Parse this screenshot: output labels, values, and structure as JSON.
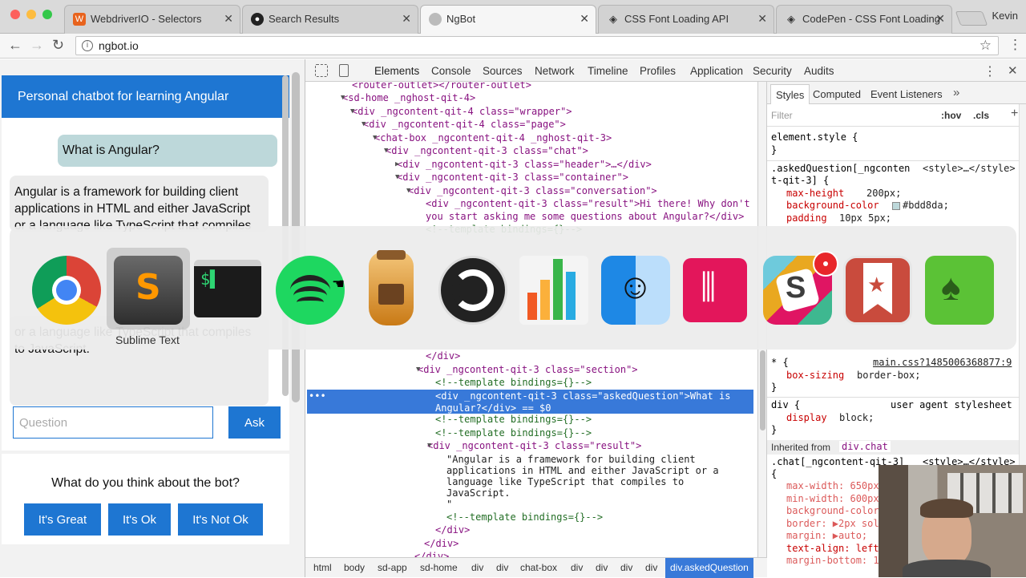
{
  "browser": {
    "tabs": [
      {
        "title": "WebdriverIO - Selectors",
        "active": false
      },
      {
        "title": "Search Results",
        "active": false
      },
      {
        "title": "NgBot",
        "active": true
      },
      {
        "title": "CSS Font Loading API",
        "active": false
      },
      {
        "title": "CodePen - CSS Font Loading",
        "active": false
      }
    ],
    "user": "Kevin",
    "url": "ngbot.io"
  },
  "page": {
    "header": "Personal chatbot for learning Angular",
    "question": "What is Angular?",
    "answer_top": "Angular is a framework for building client applications in HTML and either JavaScript or a language like TypeScript that compiles",
    "answer_bottom": "or a language like TypeScript that compiles to JavaScript.",
    "input_placeholder": "Question",
    "ask": "Ask",
    "feedback_title": "What do you think about the bot?",
    "feedback_buttons": [
      "It's Great",
      "It's Ok",
      "It's Not Ok"
    ]
  },
  "devtools": {
    "tabs": [
      "Elements",
      "Console",
      "Sources",
      "Network",
      "Timeline",
      "Profiles",
      "Application",
      "Security",
      "Audits"
    ],
    "dom": {
      "l1": "<router-outlet></router-outlet>",
      "l2": "<sd-home _nghost-qit-4>",
      "l3": "<div _ngcontent-qit-4 class=\"wrapper\">",
      "l4": "<div _ngcontent-qit-4 class=\"page\">",
      "l5": "<chat-box _ngcontent-qit-4 _nghost-qit-3>",
      "l6": "<div _ngcontent-qit-3 class=\"chat\">",
      "l7": "<div _ngcontent-qit-3 class=\"header\">…</div>",
      "l8": "<div _ngcontent-qit-3 class=\"container\">",
      "l9": "<div _ngcontent-qit-3 class=\"conversation\">",
      "l10": "<div _ngcontent-qit-3 class=\"result\">Hi there! Why don't",
      "l11": "you start asking me some questions about Angular?</div>",
      "l12": "<!--template bindings={}-->",
      "l13": "</div>",
      "l14": "<div _ngcontent-qit-3 class=\"section\">",
      "l15": "<!--template bindings={}-->",
      "l16a": "<div _ngcontent-qit-3 class=\"askedQuestion\">What is",
      "l16b": "Angular?</div> == $0",
      "l17": "<!--template bindings={}-->",
      "l18": "<!--template bindings={}-->",
      "l19": "<div _ngcontent-qit-3 class=\"result\">",
      "l20": "\"Angular is a framework for building client",
      "l21": "applications in HTML and either JavaScript or a",
      "l22": "language like TypeScript that compiles to",
      "l23": "JavaScript.",
      "l24": "\"",
      "l25": "<!--template bindings={}-->",
      "l26": "</div>",
      "l27": "</div>",
      "l28": "</div>"
    },
    "breadcrumbs": [
      "html",
      "body",
      "sd-app",
      "sd-home",
      "div",
      "div",
      "chat-box",
      "div",
      "div",
      "div",
      "div",
      "div.askedQuestion"
    ],
    "styles_tabs": [
      "Styles",
      "Computed",
      "Event Listeners"
    ],
    "filter_placeholder": "Filter",
    "hov": ":hov",
    "cls": ".cls",
    "rules": {
      "element_style": "element.style {",
      "close": "}",
      "aq_selector1": ".askedQuestion[_ngconten",
      "aq_selector2": "t-qit-3] {",
      "aq_source": "<style>…</style>",
      "aq_p1": "max-height",
      "aq_v1": "200px;",
      "aq_p2": "background-color",
      "aq_v2": "#bdd8da;",
      "aq_p3": "padding",
      "aq_v3": "10px 5px;",
      "star_selector": "* {",
      "star_source": "main.css?1485006368877:9",
      "star_p": "box-sizing",
      "star_v": "border-box;",
      "div_selector": "div {",
      "div_source": "user agent stylesheet",
      "div_p": "display",
      "div_v": "block;",
      "inherited_label": "Inherited from",
      "inherited_from": "div.chat",
      "chat_selector": ".chat[_ngcontent-qit-3]",
      "chat_source": "<style>…</style>",
      "chat_brace": "{",
      "chat_p1": "max-width: 650px",
      "chat_p2": "min-width: 600px",
      "chat_p3": "background-color",
      "chat_p4": "border: ▶2px sol",
      "chat_p5": "margin: ▶auto;",
      "chat_p6": "text-align: left",
      "chat_p7": "margin-bottom: 1"
    }
  },
  "switcher": {
    "selected_label": "Sublime Text",
    "apps": [
      "chrome-icon",
      "sublime-text-icon",
      "terminal-icon",
      "spotify-icon",
      "sequel-pro-icon",
      "obs-icon",
      "numbers-icon",
      "finder-icon",
      "gitkraken-icon",
      "slack-icon",
      "wunderlist-icon",
      "evernote-icon"
    ],
    "slack_badge_color": "#e8262a"
  },
  "colors": {
    "accent": "#1e76d2",
    "bubble": "#bdd8da",
    "devtools_selection": "#3879d9"
  }
}
